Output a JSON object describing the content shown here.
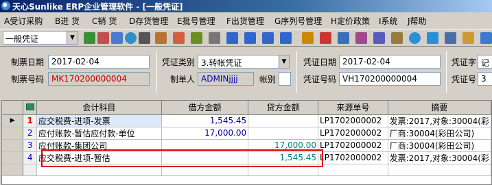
{
  "window": {
    "title": "天心Sunlike ERP企业管理软件 - [一般凭证]"
  },
  "menu": [
    "A受订采购",
    "B进 货",
    "C销 货",
    "D存货管理",
    "E批号管理",
    "F出货管理",
    "G序列号管理",
    "H定价政策",
    "I系统",
    "J帮助"
  ],
  "toolbar": {
    "doc_type": "一般凭证"
  },
  "form": {
    "voucher_date_label": "制票日期",
    "voucher_date": "2017-02-04",
    "voucher_no_label": "制票号码",
    "voucher_no": "MK170200000004",
    "category_label": "凭证类别",
    "category": "3.转帐凭证",
    "maker_label": "制单人",
    "maker": "ADMINjjjj",
    "account_book_label": "帐别",
    "cert_date_label": "凭证日期",
    "cert_date": "2017-02-04",
    "cert_no_label": "凭证号码",
    "cert_no": "VH170200000004",
    "cert_word_label": "凭证字",
    "cert_word": "记",
    "cert_num_label": "凭证号",
    "cert_num": "3"
  },
  "grid": {
    "columns": [
      "会计科目",
      "借方金额",
      "贷方金额",
      "来源单号",
      "摘要"
    ],
    "rows": [
      {
        "no": "1",
        "account": "应交税费-进项-发票",
        "debit": "1,545.45",
        "credit": "",
        "source": "LP1702000002",
        "summary": "发票:2017,对象:30004(彩"
      },
      {
        "no": "2",
        "account": "应付账款-暂估应付款-单位",
        "debit": "17,000.00",
        "credit": "",
        "source": "LP1702000002",
        "summary": "厂商:30004(彩田公司)"
      },
      {
        "no": "3",
        "account": "应付账款-集团公司",
        "debit": "",
        "credit": "17,000.00",
        "source": "LP1702000002",
        "summary": "厂商:30004(彩田公司)"
      },
      {
        "no": "4",
        "account": "应交税费-进项-暂估",
        "debit": "",
        "credit": "1,545.45",
        "source": "LP1702000002",
        "summary": "发票:2017,对象:30004(彩"
      }
    ]
  },
  "colors": {
    "highlight": "#e00000",
    "selected_row": "#dde8f8"
  }
}
